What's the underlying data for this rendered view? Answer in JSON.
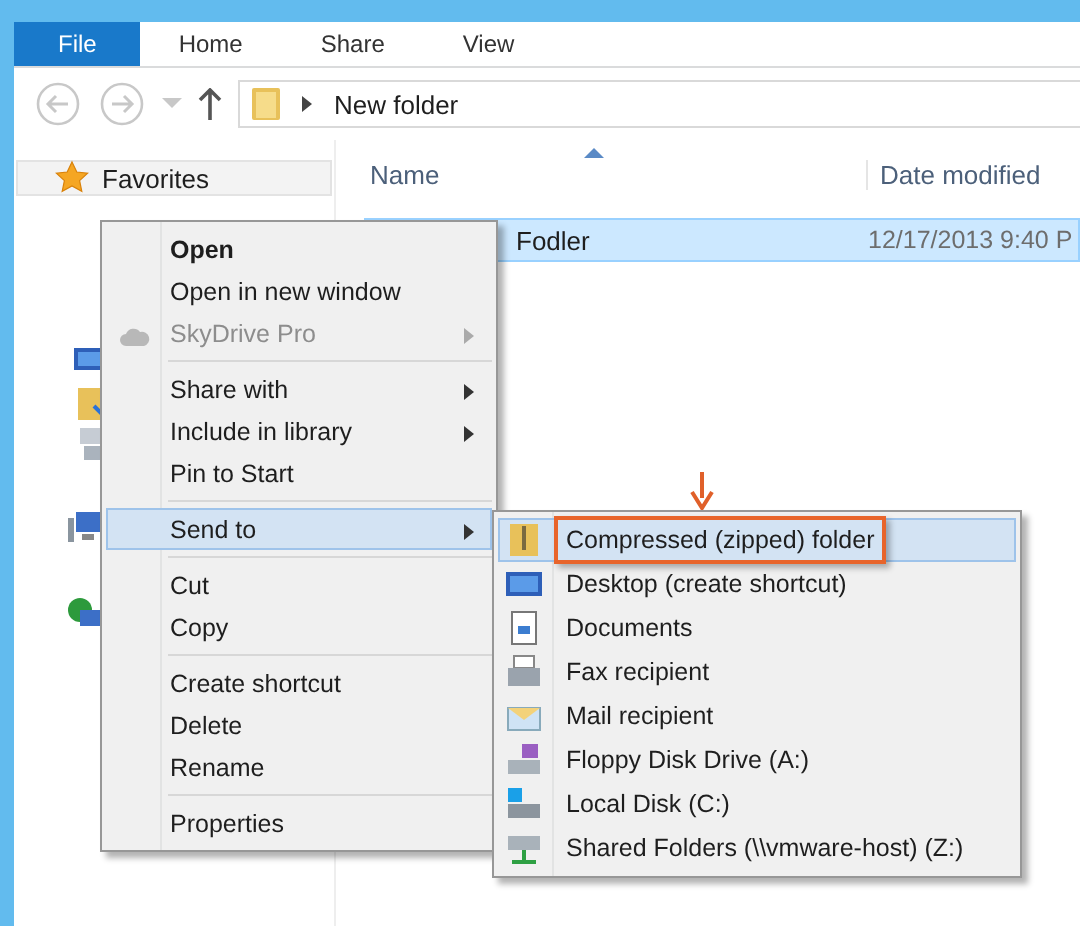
{
  "ribbon": {
    "tabs": [
      {
        "label": "File",
        "selected": true
      },
      {
        "label": "Home",
        "selected": false
      },
      {
        "label": "Share",
        "selected": false
      },
      {
        "label": "View",
        "selected": false
      }
    ]
  },
  "address_bar": {
    "path": "New folder"
  },
  "navigation_pane": {
    "favorites": "Favorites"
  },
  "file_list": {
    "columns": [
      "Name",
      "Date modified"
    ],
    "rows": [
      {
        "name": "Fodler",
        "date": "12/17/2013 9:40 P",
        "selected": true
      }
    ]
  },
  "context_menu": {
    "items": [
      {
        "kind": "item",
        "label": "Open",
        "bold": true,
        "disabled": false,
        "submenu": false,
        "selected": false
      },
      {
        "kind": "item",
        "label": "Open in new window",
        "bold": false,
        "disabled": false,
        "submenu": false,
        "selected": false
      },
      {
        "kind": "item",
        "label": "SkyDrive Pro",
        "bold": false,
        "disabled": true,
        "submenu": true,
        "selected": false
      },
      {
        "kind": "separator"
      },
      {
        "kind": "item",
        "label": "Share with",
        "bold": false,
        "disabled": false,
        "submenu": true,
        "selected": false
      },
      {
        "kind": "item",
        "label": "Include in library",
        "bold": false,
        "disabled": false,
        "submenu": true,
        "selected": false
      },
      {
        "kind": "item",
        "label": "Pin to Start",
        "bold": false,
        "disabled": false,
        "submenu": false,
        "selected": false
      },
      {
        "kind": "separator"
      },
      {
        "kind": "item",
        "label": "Send to",
        "bold": false,
        "disabled": false,
        "submenu": true,
        "selected": true
      },
      {
        "kind": "separator"
      },
      {
        "kind": "item",
        "label": "Cut",
        "bold": false,
        "disabled": false,
        "submenu": false,
        "selected": false
      },
      {
        "kind": "item",
        "label": "Copy",
        "bold": false,
        "disabled": false,
        "submenu": false,
        "selected": false
      },
      {
        "kind": "separator"
      },
      {
        "kind": "item",
        "label": "Create shortcut",
        "bold": false,
        "disabled": false,
        "submenu": false,
        "selected": false
      },
      {
        "kind": "item",
        "label": "Delete",
        "bold": false,
        "disabled": false,
        "submenu": false,
        "selected": false
      },
      {
        "kind": "item",
        "label": "Rename",
        "bold": false,
        "disabled": false,
        "submenu": false,
        "selected": false
      },
      {
        "kind": "separator"
      },
      {
        "kind": "item",
        "label": "Properties",
        "bold": false,
        "disabled": false,
        "submenu": false,
        "selected": false
      }
    ]
  },
  "send_to_menu": {
    "items": [
      {
        "label": "Compressed (zipped) folder",
        "selected": true,
        "highlighted": true
      },
      {
        "label": "Desktop (create shortcut)",
        "selected": false,
        "highlighted": false
      },
      {
        "label": "Documents",
        "selected": false,
        "highlighted": false
      },
      {
        "label": "Fax recipient",
        "selected": false,
        "highlighted": false
      },
      {
        "label": "Mail recipient",
        "selected": false,
        "highlighted": false
      },
      {
        "label": "Floppy Disk Drive (A:)",
        "selected": false,
        "highlighted": false
      },
      {
        "label": "Local Disk (C:)",
        "selected": false,
        "highlighted": false
      },
      {
        "label": "Shared Folders (\\\\vmware-host) (Z:)",
        "selected": false,
        "highlighted": false
      }
    ]
  }
}
